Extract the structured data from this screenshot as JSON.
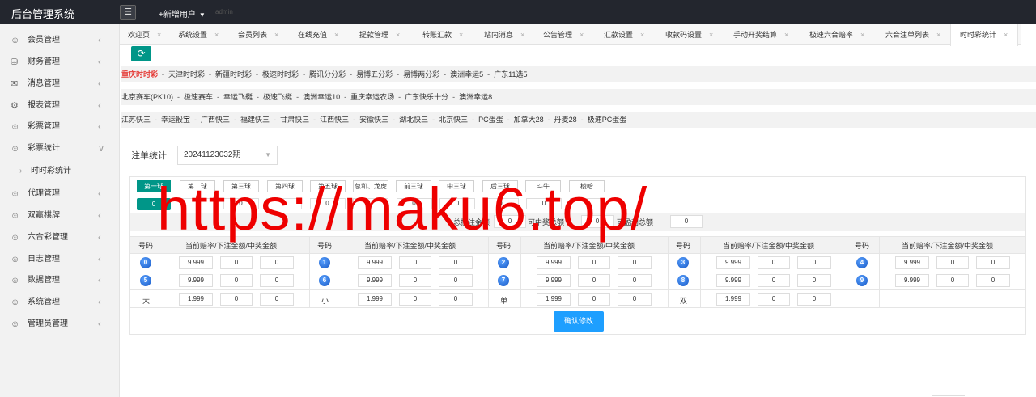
{
  "app": {
    "title": "后台管理系统",
    "menu_icon": "menu-icon",
    "add_user": "+新增用户",
    "faint_text": "admin"
  },
  "sidebar": {
    "items": [
      {
        "label": "会员管理",
        "icon": "user-icon",
        "expanded": false
      },
      {
        "label": "财务管理",
        "icon": "finance-icon",
        "expanded": false
      },
      {
        "label": "消息管理",
        "icon": "message-icon",
        "expanded": false
      },
      {
        "label": "报表管理",
        "icon": "report-icon",
        "expanded": false
      },
      {
        "label": "彩票管理",
        "icon": "user-icon",
        "expanded": false
      },
      {
        "label": "彩票统计",
        "icon": "user-icon",
        "expanded": true
      },
      {
        "label": "时时彩统计",
        "icon": "",
        "sub": true
      },
      {
        "label": "代理管理",
        "icon": "user-icon",
        "expanded": false
      },
      {
        "label": "双赢棋牌",
        "icon": "user-icon",
        "expanded": false
      },
      {
        "label": "六合彩管理",
        "icon": "user-icon",
        "expanded": false
      },
      {
        "label": "日志管理",
        "icon": "user-icon",
        "expanded": false
      },
      {
        "label": "数据管理",
        "icon": "user-icon",
        "expanded": false
      },
      {
        "label": "系统管理",
        "icon": "user-icon",
        "expanded": false
      },
      {
        "label": "管理员管理",
        "icon": "user-icon",
        "expanded": false
      }
    ]
  },
  "tabs": [
    "欢迎页",
    "系统设置",
    "会员列表",
    "在线充值",
    "提款管理",
    "转账汇款",
    "站内消息",
    "公告管理",
    "汇款设置",
    "收款码设置",
    "手动开奖结算",
    "极速六合赔率",
    "六合注单列表",
    "时时彩统计"
  ],
  "active_tab": "时时彩统计",
  "lottery_rows": [
    [
      "重庆时时彩",
      "天津时时彩",
      "新疆时时彩",
      "极速时时彩",
      "腾讯分分彩",
      "易博五分彩",
      "易博两分彩",
      "澳洲幸运5",
      "广东11选5"
    ],
    [
      "北京赛车(PK10)",
      "极速赛车",
      "幸运飞艇",
      "极速飞艇",
      "澳洲幸运10",
      "重庆幸运农场",
      "广东快乐十分",
      "澳洲幸运8"
    ],
    [
      "江苏快三",
      "幸运骰宝",
      "广西快三",
      "福建快三",
      "甘肃快三",
      "江西快三",
      "安徽快三",
      "湖北快三",
      "北京快三",
      "PC蛋蛋",
      "加拿大28",
      "丹麦28",
      "极速PC蛋蛋"
    ]
  ],
  "active_lottery": "重庆时时彩",
  "stats": {
    "label": "注单统计:",
    "period": "20241123032期"
  },
  "ball_tabs": [
    "第一球",
    "第二球",
    "第三球",
    "第四球",
    "第五球",
    "总和、龙虎",
    "前三球",
    "中三球",
    "后三球",
    "斗牛",
    "梭哈"
  ],
  "zero_button": "0",
  "mini_values": [
    "0",
    "0",
    "0",
    "0",
    "0",
    "0",
    "0",
    "0",
    "0",
    "0"
  ],
  "summary": {
    "total_label": "总投注金额",
    "total": "0",
    "winning_label": "可中奖总额",
    "winning": "0",
    "profit_label": "可盈利总额",
    "profit": "0"
  },
  "columns": {
    "code": "号码",
    "detail": "当前赔率/下注金额/中奖金额"
  },
  "rows": [
    [
      {
        "n": "0",
        "odds": "9.999",
        "bet": "0",
        "win": "0"
      },
      {
        "n": "1",
        "odds": "9.999",
        "bet": "0",
        "win": "0"
      },
      {
        "n": "2",
        "odds": "9.999",
        "bet": "0",
        "win": "0"
      },
      {
        "n": "3",
        "odds": "9.999",
        "bet": "0",
        "win": "0"
      },
      {
        "n": "4",
        "odds": "9.999",
        "bet": "0",
        "win": "0"
      }
    ],
    [
      {
        "n": "5",
        "odds": "9.999",
        "bet": "0",
        "win": "0"
      },
      {
        "n": "6",
        "odds": "9.999",
        "bet": "0",
        "win": "0"
      },
      {
        "n": "7",
        "odds": "9.999",
        "bet": "0",
        "win": "0"
      },
      {
        "n": "8",
        "odds": "9.999",
        "bet": "0",
        "win": "0"
      },
      {
        "n": "9",
        "odds": "9.999",
        "bet": "0",
        "win": "0"
      }
    ],
    [
      {
        "n": "大",
        "odds": "1.999",
        "bet": "0",
        "win": "0",
        "text": true
      },
      {
        "n": "小",
        "odds": "1.999",
        "bet": "0",
        "win": "0",
        "text": true
      },
      {
        "n": "单",
        "odds": "1.999",
        "bet": "0",
        "win": "0",
        "text": true
      },
      {
        "n": "双",
        "odds": "1.999",
        "bet": "0",
        "win": "0",
        "text": true
      }
    ]
  ],
  "confirm_label": "确认修改",
  "watermark": "https://maku6.top/",
  "colors": {
    "primary": "#009688",
    "accent": "#1e9fff",
    "active_lottery": "#e53935",
    "topbar": "#23262e",
    "watermark": "#ee0000"
  }
}
